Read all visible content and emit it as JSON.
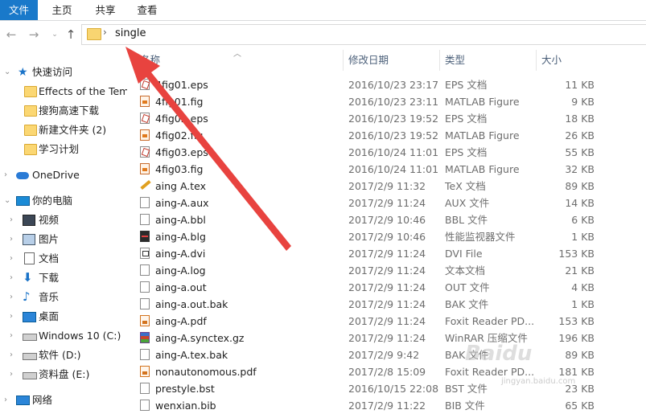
{
  "ribbon": {
    "tabs": [
      "文件",
      "主页",
      "共享",
      "查看"
    ]
  },
  "address": {
    "path_segment": "single"
  },
  "sidebar": {
    "quick_access": "快速访问",
    "quick_items": [
      "Effects of the Tem",
      "搜狗高速下载",
      "新建文件夹 (2)",
      "学习计划"
    ],
    "onedrive": "OneDrive",
    "this_pc": "你的电脑",
    "pc_items": [
      "视频",
      "图片",
      "文档",
      "下载",
      "音乐",
      "桌面",
      "Windows 10 (C:)",
      "软件 (D:)",
      "资料盘 (E:)"
    ],
    "network": "网络"
  },
  "columns": {
    "name": "名称",
    "date": "修改日期",
    "type": "类型",
    "size": "大小"
  },
  "files": [
    {
      "name": "4fig01.eps",
      "date": "2016/10/23 23:17",
      "type": "EPS 文档",
      "size": "11 KB",
      "icon": "eps"
    },
    {
      "name": "4fig01.fig",
      "date": "2016/10/23 23:11",
      "type": "MATLAB Figure",
      "size": "9 KB",
      "icon": "fig"
    },
    {
      "name": "4fig02.eps",
      "date": "2016/10/23 19:52",
      "type": "EPS 文档",
      "size": "18 KB",
      "icon": "eps"
    },
    {
      "name": "4fig02.fig",
      "date": "2016/10/23 19:52",
      "type": "MATLAB Figure",
      "size": "26 KB",
      "icon": "fig"
    },
    {
      "name": "4fig03.eps",
      "date": "2016/10/24 11:01",
      "type": "EPS 文档",
      "size": "55 KB",
      "icon": "eps"
    },
    {
      "name": "4fig03.fig",
      "date": "2016/10/24 11:01",
      "type": "MATLAB Figure",
      "size": "32 KB",
      "icon": "fig"
    },
    {
      "name": "aing A.tex",
      "date": "2017/2/9 11:32",
      "type": "TeX 文档",
      "size": "89 KB",
      "icon": "tex"
    },
    {
      "name": "aing-A.aux",
      "date": "2017/2/9 11:24",
      "type": "AUX 文件",
      "size": "14 KB",
      "icon": "file"
    },
    {
      "name": "aing-A.bbl",
      "date": "2017/2/9 10:46",
      "type": "BBL 文件",
      "size": "6 KB",
      "icon": "file"
    },
    {
      "name": "aing-A.blg",
      "date": "2017/2/9 10:46",
      "type": "性能监视器文件",
      "size": "1 KB",
      "icon": "blg"
    },
    {
      "name": "aing-A.dvi",
      "date": "2017/2/9 11:24",
      "type": "DVI File",
      "size": "153 KB",
      "icon": "dvi"
    },
    {
      "name": "aing-A.log",
      "date": "2017/2/9 11:24",
      "type": "文本文档",
      "size": "21 KB",
      "icon": "file"
    },
    {
      "name": "aing-a.out",
      "date": "2017/2/9 11:24",
      "type": "OUT 文件",
      "size": "4 KB",
      "icon": "file"
    },
    {
      "name": "aing-a.out.bak",
      "date": "2017/2/9 11:24",
      "type": "BAK 文件",
      "size": "1 KB",
      "icon": "file"
    },
    {
      "name": "aing-A.pdf",
      "date": "2017/2/9 11:24",
      "type": "Foxit Reader PD...",
      "size": "153 KB",
      "icon": "pdf"
    },
    {
      "name": "aing-A.synctex.gz",
      "date": "2017/2/9 11:24",
      "type": "WinRAR 压缩文件",
      "size": "196 KB",
      "icon": "gz"
    },
    {
      "name": "aing-A.tex.bak",
      "date": "2017/2/9 9:42",
      "type": "BAK 文件",
      "size": "89 KB",
      "icon": "file"
    },
    {
      "name": "nonautonomous.pdf",
      "date": "2017/2/8 15:09",
      "type": "Foxit Reader PD...",
      "size": "181 KB",
      "icon": "pdf"
    },
    {
      "name": "prestyle.bst",
      "date": "2016/10/15 22:08",
      "type": "BST 文件",
      "size": "23 KB",
      "icon": "file"
    },
    {
      "name": "wenxian.bib",
      "date": "2017/2/9 11:22",
      "type": "BIB 文件",
      "size": "65 KB",
      "icon": "file"
    }
  ],
  "watermark": {
    "brand": "Baidu",
    "url": "jingyan.baidu.com"
  },
  "colors": {
    "accent": "#1979ca",
    "arrow": "#e8433f",
    "folder": "#fbd773"
  }
}
